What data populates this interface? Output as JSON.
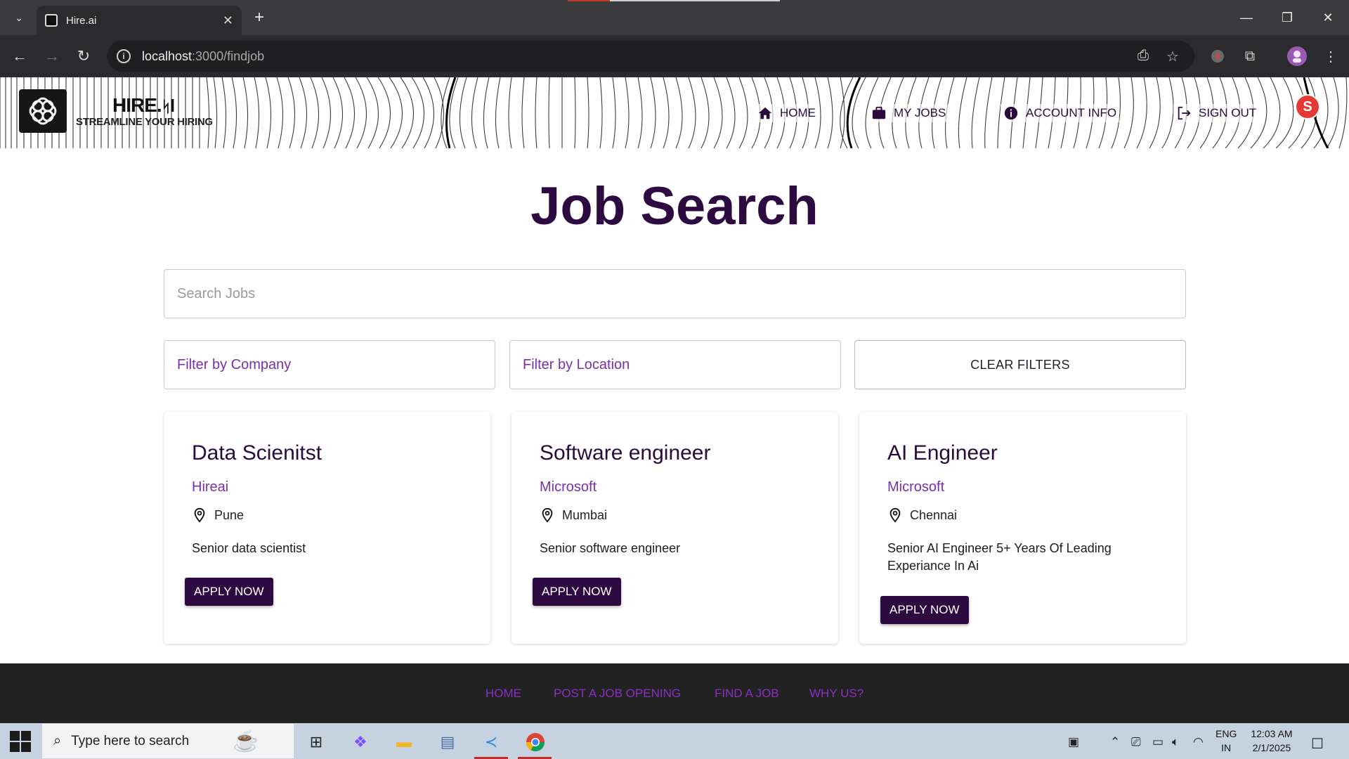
{
  "browser": {
    "tab_title": "Hire.ai",
    "url_host": "localhost",
    "url_path": ":3000/findjob"
  },
  "header": {
    "brand_name": "HIRE.",
    "brand_tagline": "STREAMLINE YOUR HIRING",
    "nav": [
      {
        "label": "HOME",
        "icon": "home-icon"
      },
      {
        "label": "MY JOBS",
        "icon": "briefcase-icon"
      },
      {
        "label": "ACCOUNT INFO",
        "icon": "info-icon"
      },
      {
        "label": "SIGN OUT",
        "icon": "sign-out-icon"
      }
    ],
    "avatar_letter": "S"
  },
  "main": {
    "title": "Job Search",
    "search_placeholder": "Search Jobs",
    "filter_company_placeholder": "Filter by Company",
    "filter_location_placeholder": "Filter by Location",
    "clear_filters_label": "CLEAR FILTERS"
  },
  "jobs": [
    {
      "title": "Data Scienitst",
      "company": "Hireai",
      "location": "Pune",
      "description": "Senior data scientist",
      "apply_label": "APPLY NOW"
    },
    {
      "title": "Software engineer",
      "company": "Microsoft",
      "location": "Mumbai",
      "description": "Senior software engineer",
      "apply_label": "APPLY NOW"
    },
    {
      "title": "AI Engineer",
      "company": "Microsoft",
      "location": "Chennai",
      "description": "Senior AI Engineer 5+ Years Of Leading Experiance In Ai",
      "apply_label": "APPLY NOW"
    }
  ],
  "footer": {
    "links": [
      "HOME",
      "POST A JOB OPENING",
      "FIND A JOB",
      "WHY US?"
    ]
  },
  "taskbar": {
    "search_placeholder": "Type here to search",
    "language": "ENG",
    "region": "IN",
    "time": "12:03 AM",
    "date": "2/1/2025"
  },
  "colors": {
    "primary": "#2d0a40",
    "accent": "#7b2fa8",
    "footer_bg": "#232222",
    "avatar": "#e53935"
  }
}
